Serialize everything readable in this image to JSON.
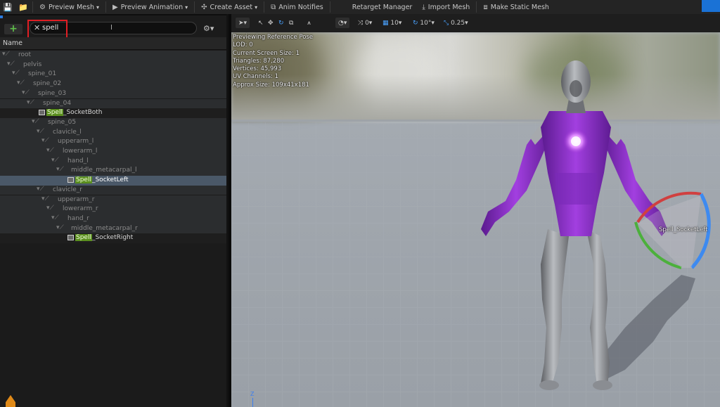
{
  "toolbar": {
    "preview_mesh": "Preview Mesh",
    "preview_animation": "Preview Animation",
    "create_asset": "Create Asset",
    "anim_notifies": "Anim Notifies",
    "retarget_manager": "Retarget Manager",
    "import_mesh": "Import Mesh",
    "make_static_mesh": "Make Static Mesh"
  },
  "left_panel": {
    "search_value": "spell",
    "column_name": "Name",
    "tree": [
      {
        "label": "root"
      },
      {
        "label": "pelvis"
      },
      {
        "label": "spine_01"
      },
      {
        "label": "spine_02"
      },
      {
        "label": "spine_03"
      },
      {
        "label": "spine_04"
      },
      {
        "match": "Spell",
        "rest": "_SocketBoth"
      },
      {
        "label": "spine_05"
      },
      {
        "label": "clavicle_l"
      },
      {
        "label": "upperarm_l"
      },
      {
        "label": "lowerarm_l"
      },
      {
        "label": "hand_l"
      },
      {
        "label": "middle_metacarpal_l"
      },
      {
        "match": "Spell",
        "rest": "_SocketLeft"
      },
      {
        "label": "clavicle_r"
      },
      {
        "label": "upperarm_r"
      },
      {
        "label": "lowerarm_r"
      },
      {
        "label": "hand_r"
      },
      {
        "label": "middle_metacarpal_r"
      },
      {
        "match": "Spell",
        "rest": "_SocketRight"
      }
    ]
  },
  "viewport_toolbar": {
    "rotation_snap": "0",
    "grid_snap": "10",
    "angle_snap": "10°",
    "scale_snap": "0.25"
  },
  "viewport": {
    "stats": [
      "Previewing Reference Pose",
      "LOD: 0",
      "Current Screen Size: 1",
      "Triangles: 87,280",
      "Vertices: 45,993",
      "UV Channels: 1",
      "Approx Size: 109x41x181"
    ],
    "socket_label": "Spell_SocketLeft",
    "axis_label": "Z"
  },
  "colors": {
    "search_highlight": "#5a8e1e",
    "selection": "#4a5868",
    "annotation_box": "#e01e24",
    "suit_purple": "#8a2bd0"
  }
}
